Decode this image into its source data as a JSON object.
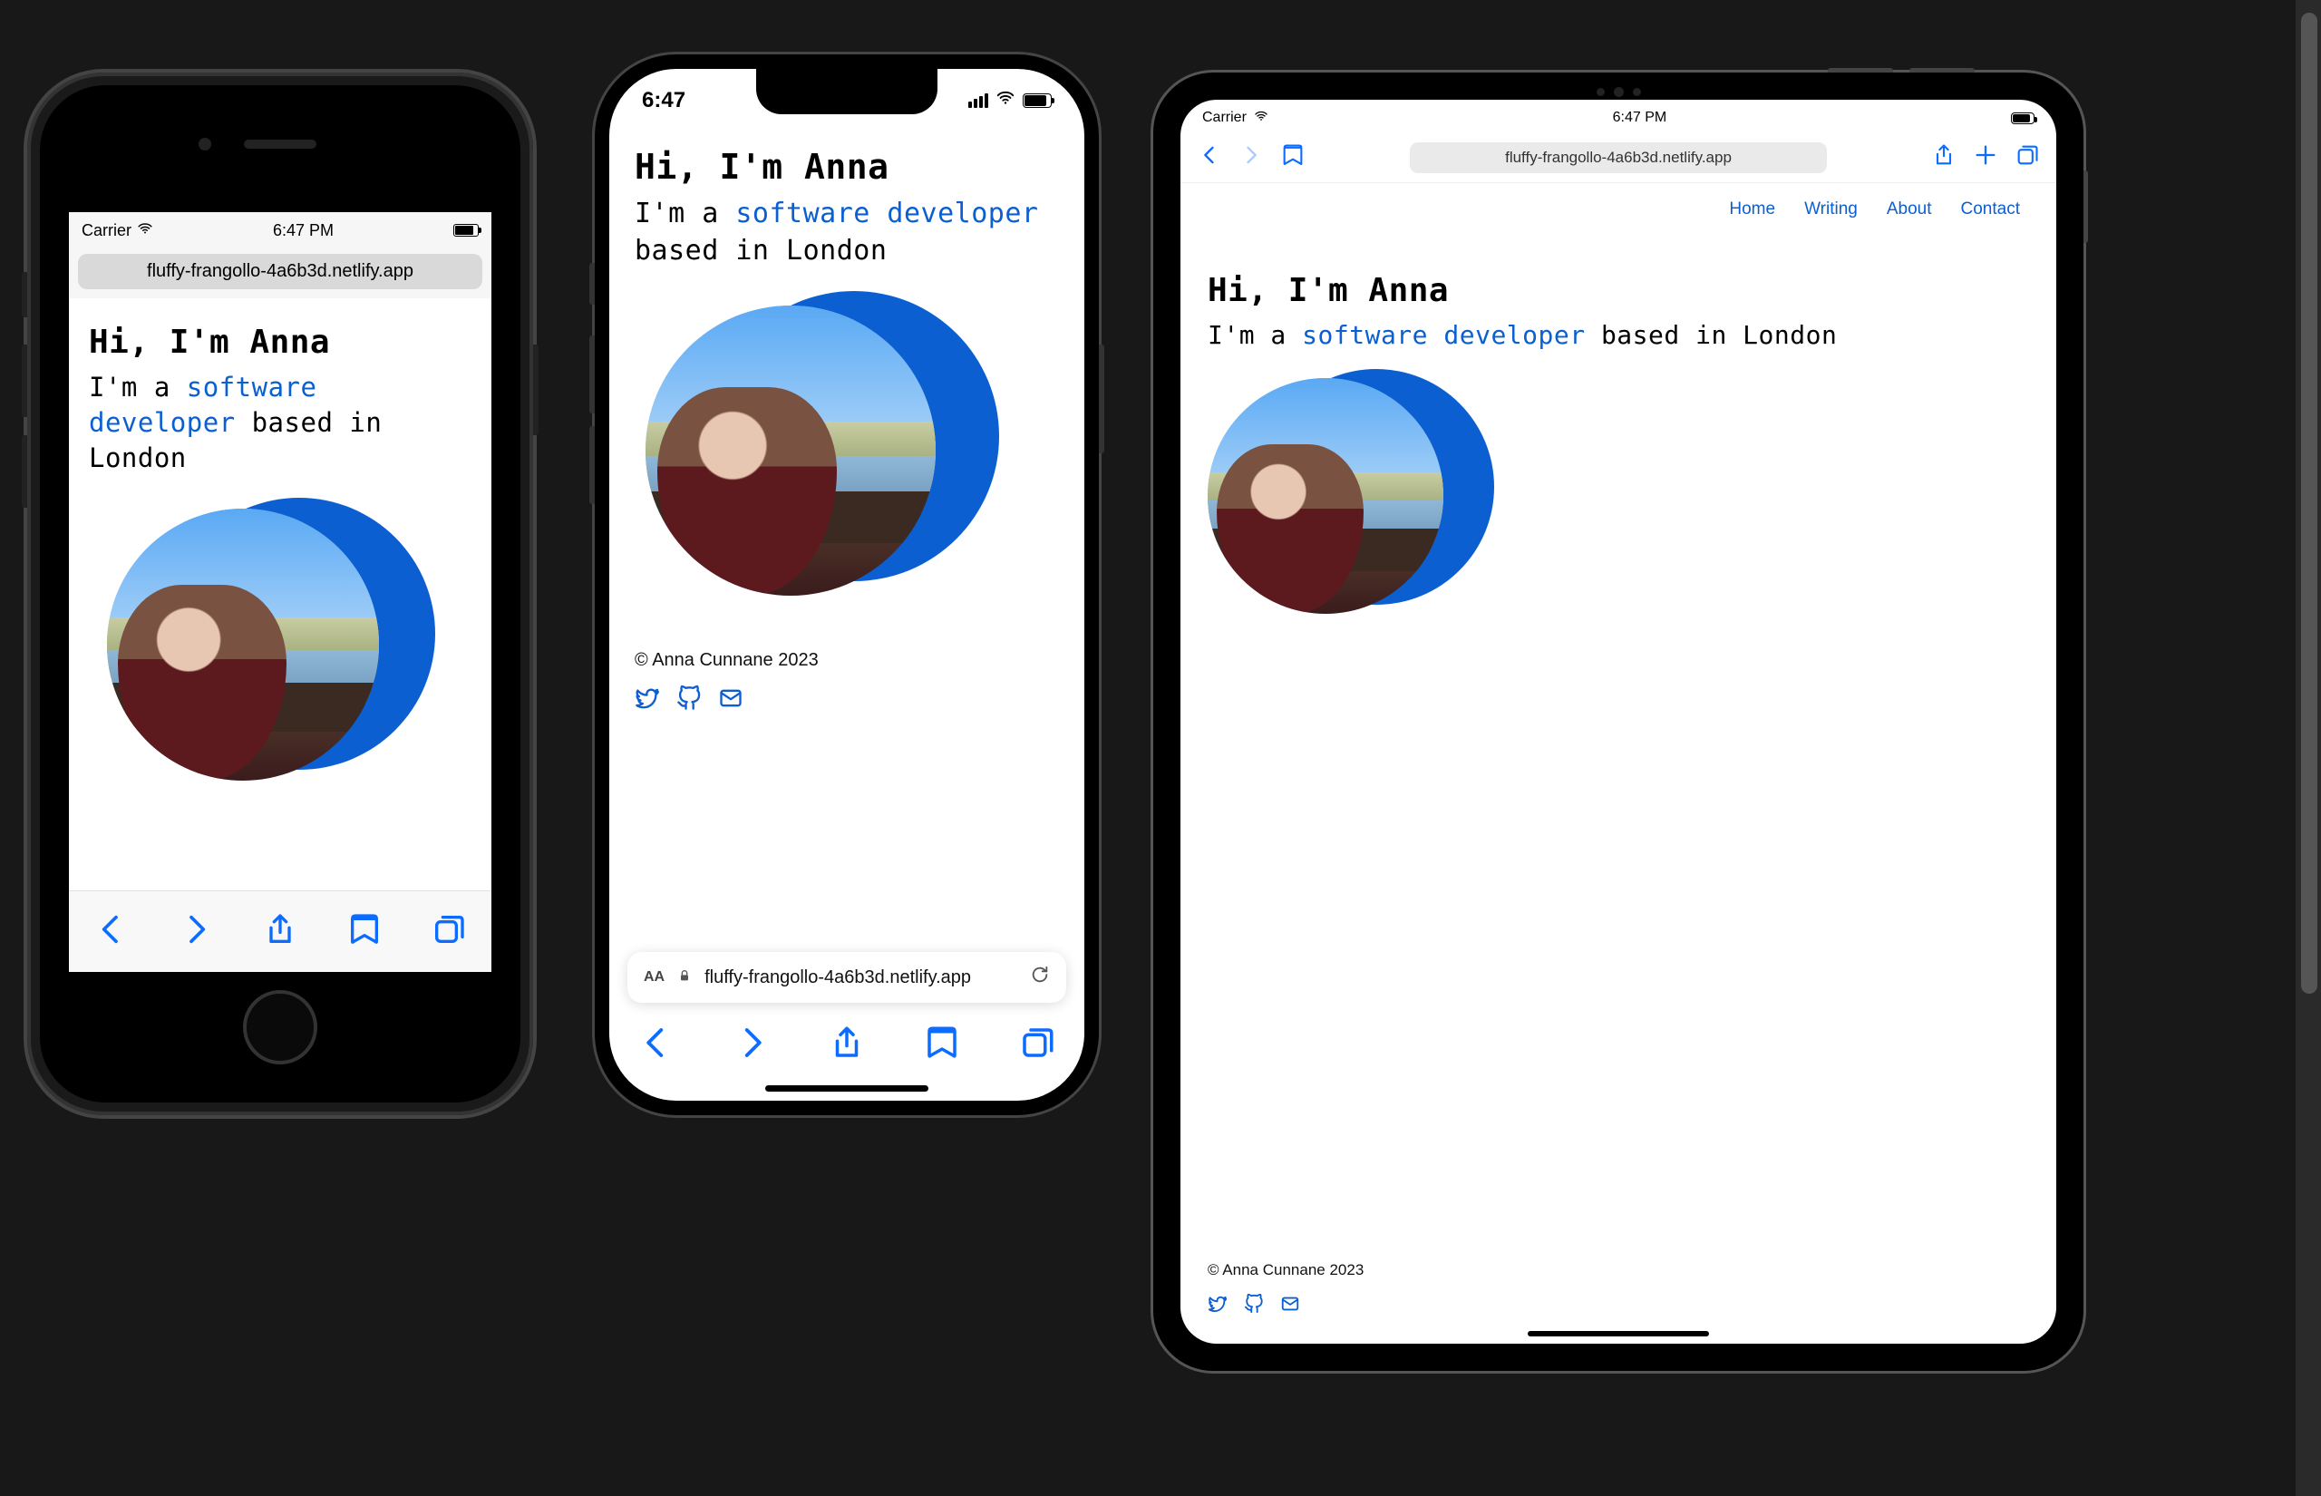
{
  "devices": {
    "iphone8": {
      "status": {
        "carrier": "Carrier",
        "time": "6:47 PM"
      },
      "url": "fluffy-frangollo-4a6b3d.netlify.app"
    },
    "iphone13": {
      "status": {
        "time": "6:47"
      },
      "url": "fluffy-frangollo-4a6b3d.netlify.app",
      "url_text_size_label": "AA"
    },
    "ipad": {
      "status": {
        "carrier": "Carrier",
        "time": "6:47 PM"
      },
      "url": "fluffy-frangollo-4a6b3d.netlify.app",
      "nav": {
        "home": "Home",
        "writing": "Writing",
        "about": "About",
        "contact": "Contact"
      }
    }
  },
  "page": {
    "title": "Hi, I'm Anna",
    "subtitle_prefix": "I'm a ",
    "subtitle_highlight": "software developer",
    "subtitle_suffix": " based in London",
    "copyright": "© Anna Cunnane 2023"
  },
  "colors": {
    "link": "#0b5fd1",
    "safari_blue": "#0b6cff",
    "page_bg": "#181818"
  },
  "icons": {
    "wifi": "wifi-icon",
    "battery": "battery-icon",
    "signal": "cellular-signal-icon",
    "back": "back-icon",
    "forward": "forward-icon",
    "share": "share-icon",
    "bookmarks": "bookmarks-icon",
    "tabs": "tabs-icon",
    "lock": "lock-icon",
    "reload": "reload-icon",
    "plus": "plus-icon",
    "book": "book-icon",
    "twitter": "twitter-icon",
    "github": "github-icon",
    "mail": "mail-icon"
  }
}
